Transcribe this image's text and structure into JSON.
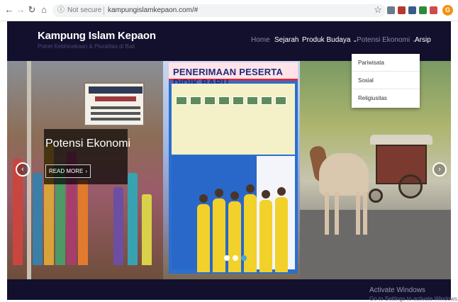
{
  "browser": {
    "not_secure": "Not secure",
    "url": "kampungislamkepaon.com/#"
  },
  "site": {
    "title": "Kampung Islam Kepaon",
    "tagline": "Potret Kebhinekaan & Pluralitas di Bali"
  },
  "nav": {
    "home": "Home",
    "sejarah": "Sejarah",
    "produk_budaya": "Produk Budaya",
    "potensi_ekonomi": "Potensi Ekonomi",
    "arsip": "Arsip",
    "caret": "⌄"
  },
  "dropdown": {
    "items": [
      "Pariwisata",
      "Sosial",
      "Religiusitas"
    ]
  },
  "slide": {
    "title": "Potensi Ekonomi",
    "button": "READ MORE",
    "button_chevron": "›"
  },
  "banner": {
    "headline": "PENERIMAAN PESERTA DIDIK BARU"
  },
  "slider": {
    "prev": "‹",
    "next": "›",
    "dots_total": 3,
    "dots_active": 3
  },
  "windows": {
    "activate": "Activate Windows",
    "sub": "Go to Settings to activate Windows."
  },
  "colors": {
    "header_bg": "#13102e",
    "dot_active": "#4aa3df",
    "profile": "#f29111"
  },
  "icons": [
    "back-icon",
    "forward-icon",
    "reload-icon",
    "home-icon",
    "info-icon",
    "star-icon",
    "extension-icon",
    "profile-icon",
    "chevron-left-icon",
    "chevron-right-icon"
  ]
}
